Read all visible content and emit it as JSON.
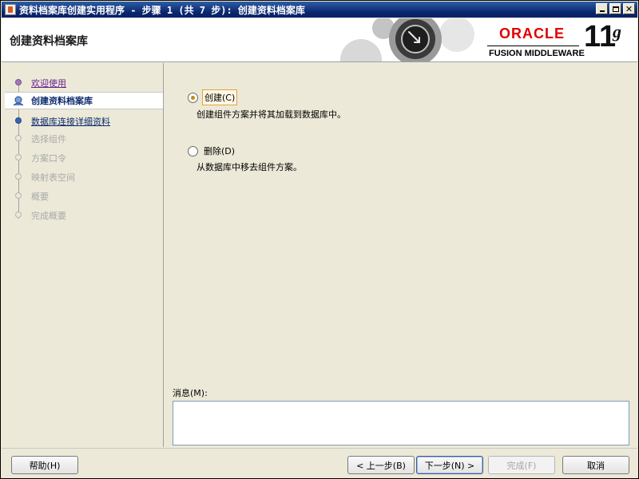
{
  "window": {
    "title": "资料档案库创建实用程序 - 步骤 1 (共 7 步): 创建资料档案库",
    "controls": {
      "minimize": "_",
      "maximize": "□",
      "close": "✕"
    }
  },
  "header": {
    "page_title": "创建资料档案库",
    "brand": {
      "oracle": "ORACLE",
      "trademark": "®",
      "product": "FUSION MIDDLEWARE",
      "version": "11",
      "version_suffix": "g"
    },
    "colors": {
      "oracle_red": "#e00000"
    }
  },
  "nav": {
    "items": [
      {
        "label": "欢迎使用",
        "state": "visited"
      },
      {
        "label": "创建资料档案库",
        "state": "current"
      },
      {
        "label": "数据库连接详细资料",
        "state": "next"
      },
      {
        "label": "选择组件",
        "state": "disabled"
      },
      {
        "label": "方案口令",
        "state": "disabled"
      },
      {
        "label": "映射表空间",
        "state": "disabled"
      },
      {
        "label": "概要",
        "state": "disabled"
      },
      {
        "label": "完成概要",
        "state": "disabled"
      }
    ]
  },
  "options": {
    "create": {
      "label": "创建(C)",
      "mnemonic": "C",
      "description": "创建组件方案并将其加载到数据库中。",
      "checked": true
    },
    "drop": {
      "label": "删除(D)",
      "mnemonic": "D",
      "description": "从数据库中移去组件方案。",
      "checked": false
    }
  },
  "messages": {
    "label": "消息(M):",
    "value": ""
  },
  "buttons": {
    "help": "帮助(H)",
    "back": "< 上一步(B)",
    "next": "下一步(N) >",
    "finish": "完成(F)",
    "cancel": "取消"
  }
}
